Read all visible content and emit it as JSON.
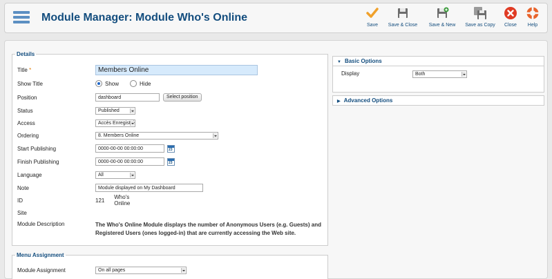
{
  "header": {
    "title": "Module Manager: Module Who's Online"
  },
  "toolbar": {
    "save": "Save",
    "save_close": "Save & Close",
    "save_new": "Save & New",
    "save_copy": "Save as Copy",
    "close": "Close",
    "help": "Help"
  },
  "details": {
    "legend": "Details",
    "title_label": "Title",
    "title_required": "*",
    "title_value": "Members Online",
    "show_title_label": "Show Title",
    "show_option": "Show",
    "hide_option": "Hide",
    "position_label": "Position",
    "position_value": "dashboard",
    "select_position": "Select position",
    "status_label": "Status",
    "status_value": "Published",
    "access_label": "Access",
    "access_value": "Accès Enregistré",
    "ordering_label": "Ordering",
    "ordering_value": "8. Members Online",
    "start_label": "Start Publishing",
    "start_value": "0000-00-00 00:00:00",
    "finish_label": "Finish Publishing",
    "finish_value": "0000-00-00 00:00:00",
    "calendar_day": "23",
    "language_label": "Language",
    "language_value": "All",
    "note_label": "Note",
    "note_value": "Module displayed on My Dashboard",
    "id_label": "ID",
    "id_value": "121",
    "id_name": "Who's Online",
    "site_label": "Site",
    "desc_label": "Module Description",
    "desc_value": "The Who's Online Module displays the number of Anonymous Users (e.g. Guests) and Registered Users (ones logged-in) that are currently accessing the Web site."
  },
  "menu_assignment": {
    "legend": "Menu Assignment",
    "label": "Module Assignment",
    "value": "On all pages"
  },
  "basic_options": {
    "header": "Basic Options",
    "display_label": "Display",
    "display_value": "Both"
  },
  "advanced_options": {
    "header": "Advanced Options"
  },
  "colors": {
    "accent": "#134d7e",
    "save": "#f0a12b",
    "close": "#e03b24"
  }
}
